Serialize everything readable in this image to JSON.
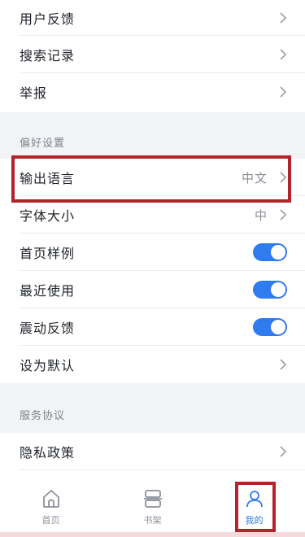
{
  "top_items": [
    {
      "label": "用户反馈"
    },
    {
      "label": "搜索记录"
    },
    {
      "label": "举报"
    }
  ],
  "preferences": {
    "header": "偏好设置",
    "items": [
      {
        "label": "输出语言",
        "value": "中文"
      },
      {
        "label": "字体大小",
        "value": "中"
      },
      {
        "label": "首页样例",
        "toggle": "on"
      },
      {
        "label": "最近使用",
        "toggle": "on"
      },
      {
        "label": "震动反馈",
        "toggle": "on"
      },
      {
        "label": "设为默认"
      }
    ]
  },
  "service": {
    "header": "服务协议",
    "items": [
      {
        "label": "隐私政策"
      }
    ]
  },
  "tabbar": {
    "tabs": [
      {
        "label": "首页",
        "icon": "home-icon"
      },
      {
        "label": "书架",
        "icon": "bookshelf-icon"
      },
      {
        "label": "我的",
        "icon": "profile-icon",
        "active": true
      }
    ]
  },
  "colors": {
    "accent": "#2f7bf0",
    "highlight": "#b3232a"
  }
}
